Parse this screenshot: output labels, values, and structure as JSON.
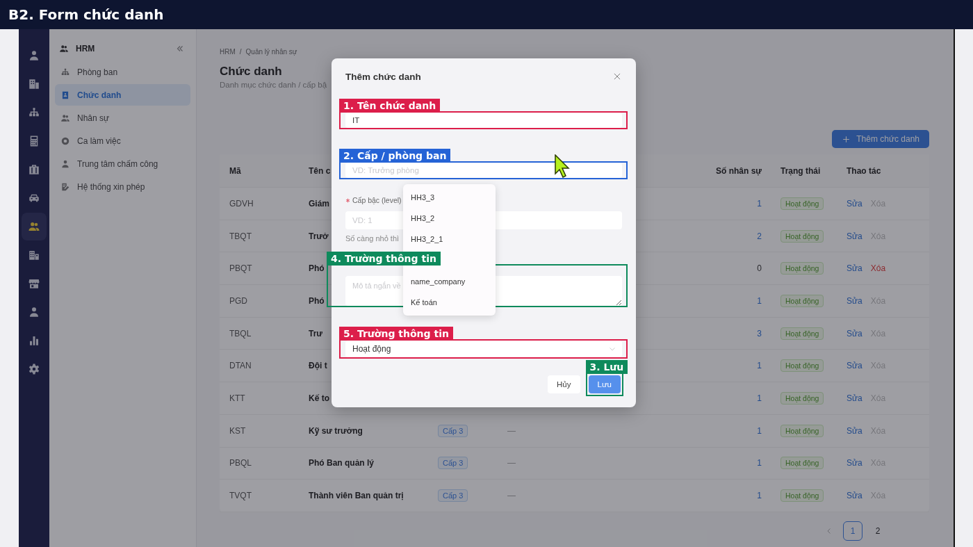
{
  "banner": {
    "title": "B2. Form chức danh"
  },
  "rail": {
    "items": [
      {
        "kind": "user",
        "selected": false
      },
      {
        "kind": "building",
        "selected": false
      },
      {
        "kind": "tree",
        "selected": false
      },
      {
        "kind": "calculator",
        "selected": false
      },
      {
        "kind": "briefcase",
        "selected": false
      },
      {
        "kind": "car",
        "selected": false
      },
      {
        "kind": "users",
        "selected": true
      },
      {
        "kind": "office",
        "selected": false
      },
      {
        "kind": "store",
        "selected": false
      },
      {
        "kind": "user",
        "selected": false
      },
      {
        "kind": "chart",
        "selected": false
      },
      {
        "kind": "gear",
        "selected": false
      }
    ]
  },
  "sidebar": {
    "title": "HRM",
    "items": [
      {
        "label": "Phòng ban",
        "kind": "tree",
        "selected": false
      },
      {
        "label": "Chức danh",
        "kind": "badge",
        "selected": true
      },
      {
        "label": "Nhân sự",
        "kind": "users",
        "selected": false
      },
      {
        "label": "Ca làm việc",
        "kind": "circle",
        "selected": false
      },
      {
        "label": "Trung tâm chấm công",
        "kind": "user",
        "selected": false
      },
      {
        "label": "Hệ thống xin phép",
        "kind": "doc",
        "selected": false
      }
    ]
  },
  "page": {
    "breadcrumb": [
      "HRM",
      "Quản lý nhân sự"
    ],
    "separator": "/",
    "title": "Chức danh",
    "subtitle": "Danh mục chức danh / cấp bậ",
    "add_button": "Thêm chức danh"
  },
  "table": {
    "columns": [
      "Mã",
      "Tên c",
      "Số nhân sự",
      "Trạng thái",
      "Thao tác"
    ],
    "rows": [
      {
        "code": "GDVH",
        "name": "Giám",
        "count": "1",
        "count_link": true,
        "status": "Hoạt động",
        "edit": "Sửa",
        "delete": {
          "label": "Xóa",
          "disabled": true
        }
      },
      {
        "code": "TBQT",
        "name": "Trưở",
        "count": "2",
        "count_link": true,
        "status": "Hoạt động",
        "edit": "Sửa",
        "delete": {
          "label": "Xóa",
          "disabled": true
        }
      },
      {
        "code": "PBQT",
        "name": "Phó",
        "count": "0",
        "count_link": false,
        "status": "Hoạt động",
        "edit": "Sửa",
        "delete": {
          "label": "Xóa",
          "disabled": false
        }
      },
      {
        "code": "PGD",
        "name": "Phó",
        "count": "1",
        "count_link": true,
        "status": "Hoạt động",
        "edit": "Sửa",
        "delete": {
          "label": "Xóa",
          "disabled": true
        }
      },
      {
        "code": "TBQL",
        "name": "Trư",
        "count": "3",
        "count_link": true,
        "status": "Hoạt động",
        "edit": "Sửa",
        "delete": {
          "label": "Xóa",
          "disabled": true
        }
      },
      {
        "code": "DTAN",
        "name": "Đội t",
        "count": "1",
        "count_link": true,
        "status": "Hoạt động",
        "edit": "Sửa",
        "delete": {
          "label": "Xóa",
          "disabled": true
        }
      },
      {
        "code": "KTT",
        "name": "Kế to",
        "count": "1",
        "count_link": true,
        "status": "Hoạt động",
        "edit": "Sửa",
        "delete": {
          "label": "Xóa",
          "disabled": true
        }
      },
      {
        "code": "KST",
        "name": "Kỹ sư trưởng",
        "level": "Cấp 3",
        "note": "—",
        "count": "1",
        "count_link": true,
        "status": "Hoạt động",
        "edit": "Sửa",
        "delete": {
          "label": "Xóa",
          "disabled": true
        }
      },
      {
        "code": "PBQL",
        "name": "Phó Ban quản lý",
        "level": "Cấp 3",
        "note": "—",
        "count": "1",
        "count_link": true,
        "status": "Hoạt động",
        "edit": "Sửa",
        "delete": {
          "label": "Xóa",
          "disabled": true
        }
      },
      {
        "code": "TVQT",
        "name": "Thành viên Ban quản trị",
        "level": "Cấp 3",
        "note": "—",
        "count": "1",
        "count_link": true,
        "status": "Hoạt động",
        "edit": "Sửa",
        "delete": {
          "label": "Xóa",
          "disabled": true
        }
      }
    ]
  },
  "pagination": {
    "pages": [
      {
        "label": "1",
        "selected": true
      },
      {
        "label": "2",
        "selected": false
      }
    ]
  },
  "modal": {
    "title": "Thêm chức danh",
    "fields": [
      {
        "kind": "input",
        "value": "IT",
        "annotation": {
          "label": "1. Tên chức danh",
          "color": "#dc1e4a"
        }
      },
      {
        "kind": "input",
        "placeholder": "VD: Trưởng phòng",
        "annotation": {
          "label": "2. Cấp / phòng ban",
          "color": "#2563d6"
        },
        "options": [
          "HH3_3",
          "HH3_2",
          "HH3_2_1",
          "name_company",
          "Kế toán"
        ]
      },
      {
        "kind": "input",
        "label": "Cấp bậc (level)",
        "required": true,
        "placeholder": "VD: 1",
        "help": "Số càng nhỏ thì"
      },
      {
        "kind": "textarea",
        "placeholder": "Mô tả ngắn về",
        "annotation": {
          "label": "4. Trường thông tin",
          "color": "#0e8a5c"
        }
      },
      {
        "kind": "select",
        "value": "Hoạt động",
        "annotation": {
          "label": "5. Trường thông tin",
          "color": "#dc1e4a"
        }
      }
    ],
    "buttons": [
      {
        "label": "Hủy",
        "primary": false
      },
      {
        "label": "Lưu",
        "primary": true,
        "annotation": {
          "label": "3. Lưu",
          "color": "#0e8a5c"
        }
      }
    ]
  }
}
